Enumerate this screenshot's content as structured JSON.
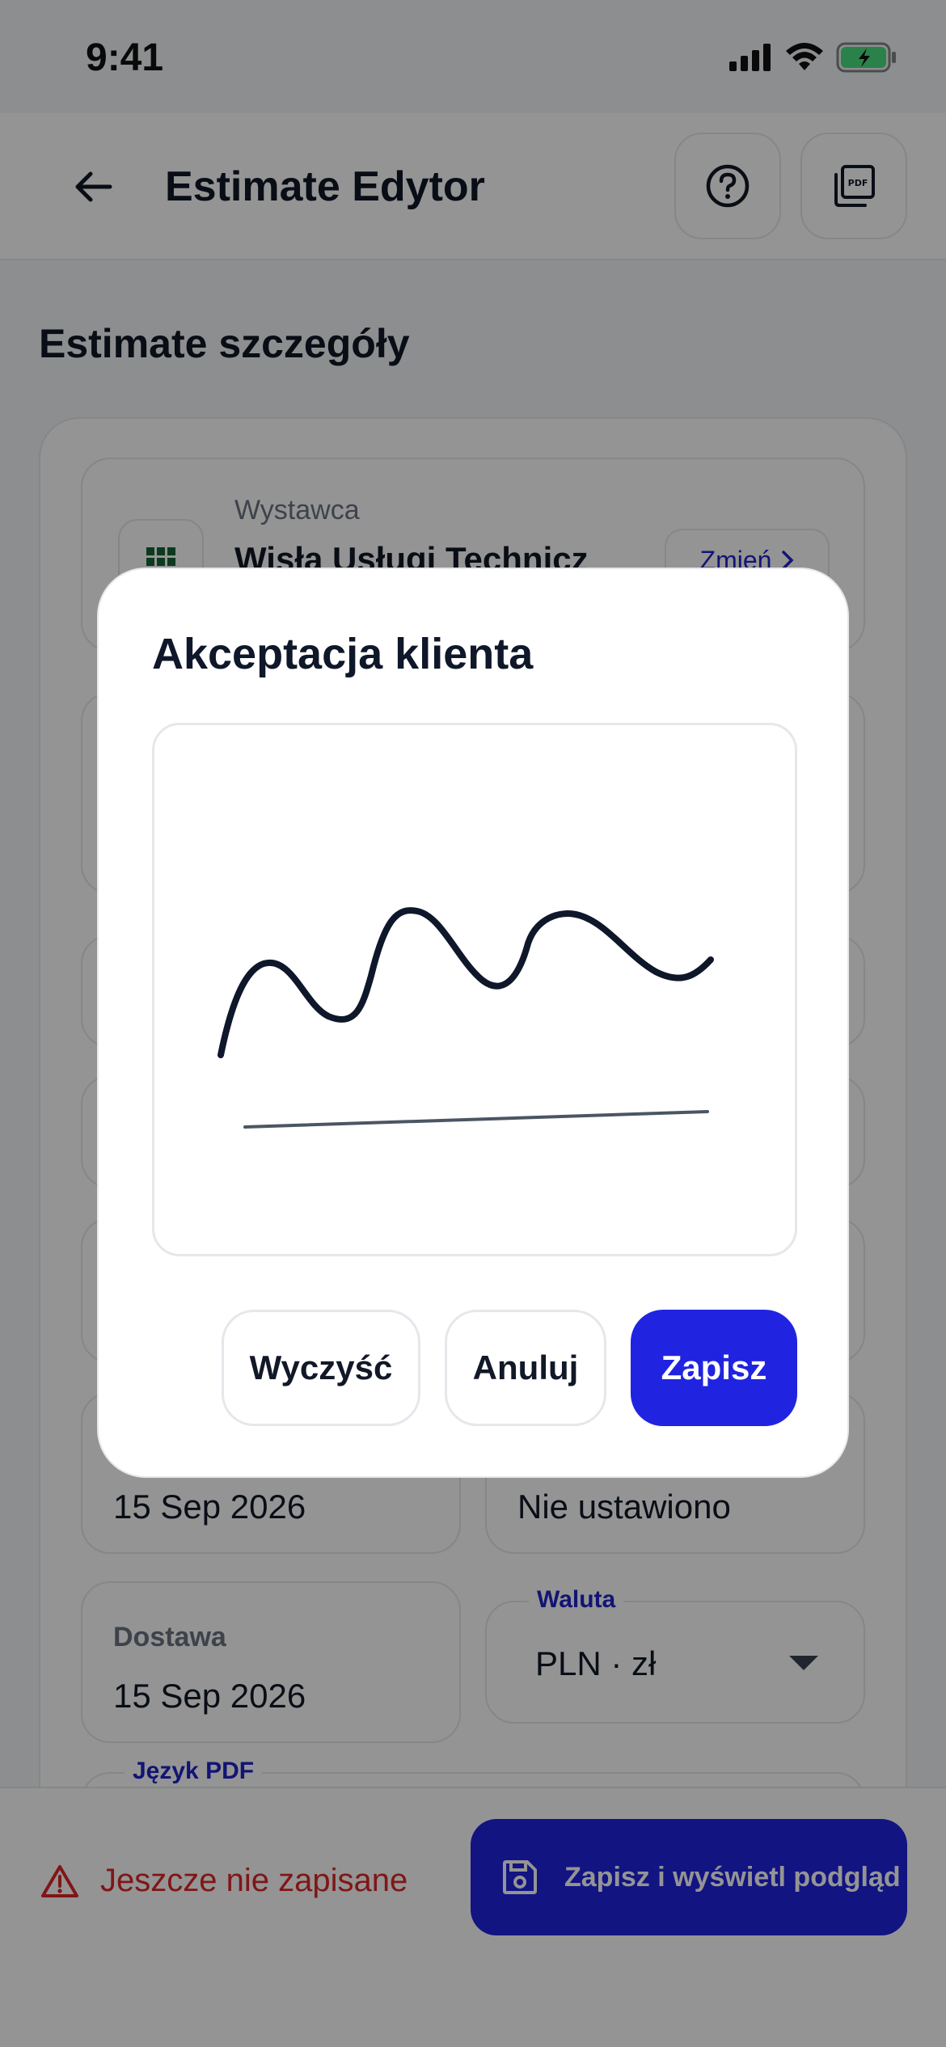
{
  "status_bar": {
    "time": "9:41"
  },
  "header": {
    "title": "Estimate Edytor",
    "pdf_icon_text": "PDF"
  },
  "page": {
    "section_title": "Estimate szczegóły"
  },
  "issuer": {
    "label": "Wystawca",
    "name": "Wisła Usługi Technicz",
    "change_label": "Zmień"
  },
  "dates": [
    {
      "label": "",
      "value": "15 Sep 2026"
    },
    {
      "label": "",
      "value": "Nie ustawiono"
    },
    {
      "label": "Dostawa",
      "value": "15 Sep 2026"
    }
  ],
  "currency": {
    "label": "Waluta",
    "value": "PLN · zł"
  },
  "pdf_language": {
    "label": "Język PDF"
  },
  "bottom_bar": {
    "unsaved_text": "Jeszcze nie zapisane",
    "save_preview_label": "Zapisz i wyświetl podgląd"
  },
  "modal": {
    "title": "Akceptacja klienta",
    "clear_label": "Wyczyść",
    "cancel_label": "Anuluj",
    "save_label": "Zapisz"
  },
  "colors": {
    "accent": "#2024E0",
    "danger": "#DC2626",
    "ink": "#111827"
  }
}
